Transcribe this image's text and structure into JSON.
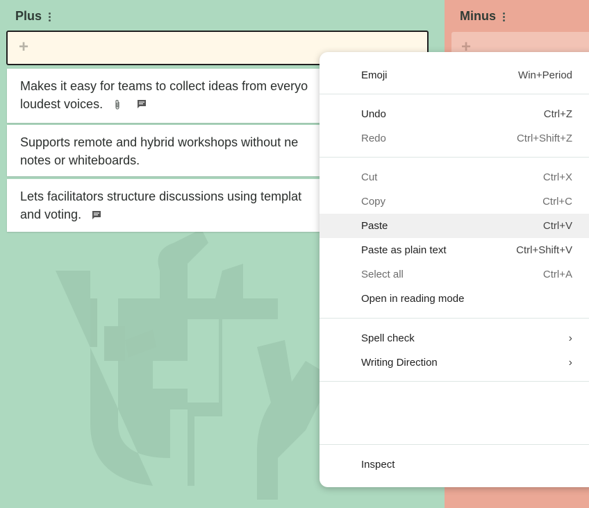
{
  "columns": {
    "plus": {
      "title": "Plus",
      "color": "#add9bf"
    },
    "minus": {
      "title": "Minus",
      "color": "#eba896"
    }
  },
  "input": {
    "plus_glyph": "+",
    "border_color": "#1f1f1f",
    "background": "#fff8e8"
  },
  "cards": [
    {
      "line1": "Makes it easy for teams to collect ideas from everyo",
      "line2": "loudest voices.",
      "has_attachment": true,
      "has_comment": true
    },
    {
      "line1": "Supports remote and hybrid workshops without ne",
      "line2": "notes or whiteboards.",
      "has_attachment": false,
      "has_comment": false
    },
    {
      "line1": "Lets facilitators structure discussions using templat",
      "line2": "and voting.",
      "has_attachment": false,
      "has_comment": true
    }
  ],
  "context_menu": {
    "items": [
      {
        "label": "Emoji",
        "shortcut": "Win+Period",
        "disabled": false
      },
      {
        "label": "Undo",
        "shortcut": "Ctrl+Z",
        "disabled": false
      },
      {
        "label": "Redo",
        "shortcut": "Ctrl+Shift+Z",
        "disabled": true
      },
      {
        "label": "Cut",
        "shortcut": "Ctrl+X",
        "disabled": true
      },
      {
        "label": "Copy",
        "shortcut": "Ctrl+C",
        "disabled": true
      },
      {
        "label": "Paste",
        "shortcut": "Ctrl+V",
        "disabled": false,
        "hovered": true
      },
      {
        "label": "Paste as plain text",
        "shortcut": "Ctrl+Shift+V",
        "disabled": false
      },
      {
        "label": "Select all",
        "shortcut": "Ctrl+A",
        "disabled": true
      },
      {
        "label": "Open in reading mode",
        "shortcut": "",
        "disabled": false
      },
      {
        "label": "Spell check",
        "submenu": true,
        "disabled": false
      },
      {
        "label": "Writing Direction",
        "submenu": true,
        "disabled": false
      },
      {
        "label": "Inspect",
        "shortcut": "",
        "disabled": false
      }
    ]
  }
}
